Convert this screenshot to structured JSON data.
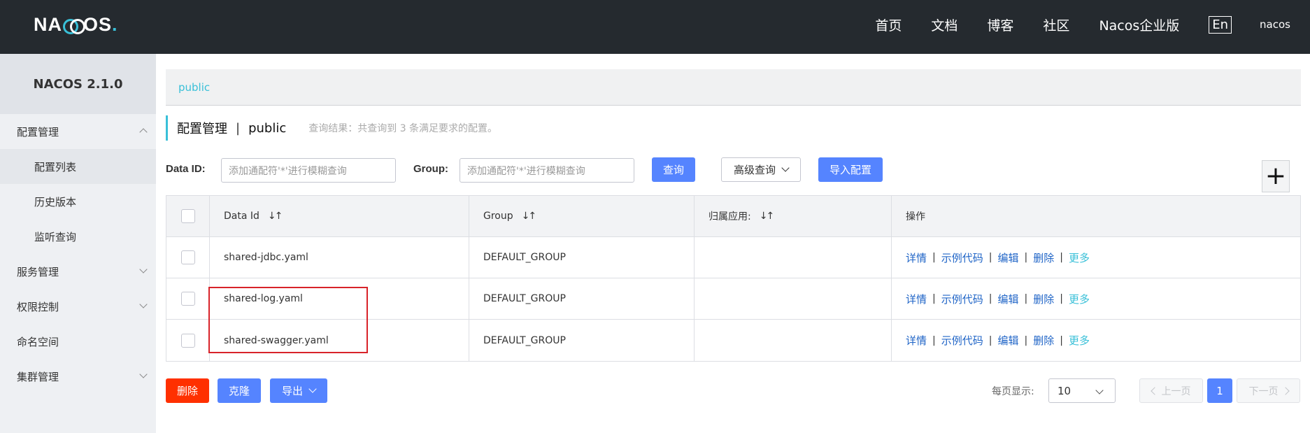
{
  "header": {
    "logo_text_1": "NA",
    "logo_text_2": "OS",
    "logo_dot": ".",
    "nav": [
      "首页",
      "文档",
      "博客",
      "社区",
      "Nacos企业版"
    ],
    "lang": "En",
    "user": "nacos"
  },
  "sidebar": {
    "version": "NACOS 2.1.0",
    "items": [
      {
        "label": "配置管理",
        "expanded": true
      },
      {
        "label": "配置列表",
        "sub": true,
        "active": true
      },
      {
        "label": "历史版本",
        "sub": true
      },
      {
        "label": "监听查询",
        "sub": true
      },
      {
        "label": "服务管理",
        "expanded": false
      },
      {
        "label": "权限控制",
        "expanded": false
      },
      {
        "label": "命名空间"
      },
      {
        "label": "集群管理",
        "expanded": false
      }
    ]
  },
  "breadcrumb": "public",
  "title": {
    "main": "配置管理",
    "sep": "|",
    "namespace": "public",
    "result": "查询结果：共查询到 3 条满足要求的配置。"
  },
  "filters": {
    "data_id_label": "Data ID:",
    "data_id_placeholder": "添加通配符'*'进行模糊查询",
    "group_label": "Group:",
    "group_placeholder": "添加通配符'*'进行模糊查询",
    "search": "查询",
    "advanced": "高级查询",
    "import": "导入配置",
    "add": "+"
  },
  "table": {
    "headers": [
      "Data Id",
      "Group",
      "归属应用:",
      "操作"
    ],
    "sort_glyph": "↓↑",
    "rows": [
      {
        "data_id": "shared-jdbc.yaml",
        "group": "DEFAULT_GROUP",
        "app": ""
      },
      {
        "data_id": "shared-log.yaml",
        "group": "DEFAULT_GROUP",
        "app": ""
      },
      {
        "data_id": "shared-swagger.yaml",
        "group": "DEFAULT_GROUP",
        "app": ""
      }
    ],
    "ops": [
      "详情",
      "示例代码",
      "编辑",
      "删除",
      "更多"
    ],
    "ops_sep": "|"
  },
  "bottom": {
    "delete": "删除",
    "clone": "克隆",
    "export": "导出",
    "page_size_label": "每页显示:",
    "page_size": "10",
    "prev": "上一页",
    "current_page": "1",
    "next": "下一页"
  },
  "colors": {
    "topbar": "#252a2f",
    "accent": "#39c0d8",
    "primary": "#5584ff",
    "danger": "#ff3000",
    "link": "#2065c7",
    "highlight": "#d8232a"
  }
}
